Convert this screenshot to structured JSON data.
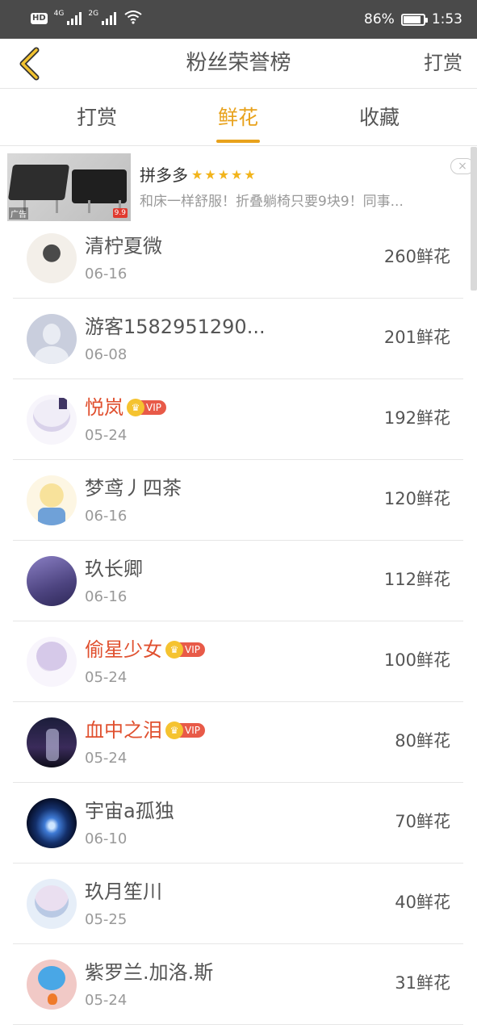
{
  "status_bar": {
    "hd": "HD",
    "network1": "4G",
    "network2": "2G",
    "battery": "86%",
    "battery_level": 0.86,
    "time": "1:53"
  },
  "header": {
    "title": "粉丝荣誉榜",
    "right_action": "打赏"
  },
  "tabs": [
    {
      "label": "打赏",
      "active": false
    },
    {
      "label": "鲜花",
      "active": true
    },
    {
      "label": "收藏",
      "active": false
    }
  ],
  "ad": {
    "title": "拼多多",
    "stars": "★★★★★",
    "description": "和床一样舒服！折叠躺椅只要9块9！同事...",
    "ad_label": "广告",
    "price_tag": "9.9",
    "close": "×"
  },
  "fans": [
    {
      "name": "清柠夏微",
      "date": "06-16",
      "amount": "260鲜花",
      "vip": false
    },
    {
      "name": "游客1582951290...",
      "date": "06-08",
      "amount": "201鲜花",
      "vip": false
    },
    {
      "name": "悦岚",
      "date": "05-24",
      "amount": "192鲜花",
      "vip": true
    },
    {
      "name": "梦鸢丿四茶",
      "date": "06-16",
      "amount": "120鲜花",
      "vip": false
    },
    {
      "name": "玖长卿",
      "date": "06-16",
      "amount": "112鲜花",
      "vip": false
    },
    {
      "name": "偷星少女",
      "date": "05-24",
      "amount": "100鲜花",
      "vip": true
    },
    {
      "name": "血中之泪",
      "date": "05-24",
      "amount": "80鲜花",
      "vip": true
    },
    {
      "name": "宇宙a孤独",
      "date": "06-10",
      "amount": "70鲜花",
      "vip": false
    },
    {
      "name": "玖月笙川",
      "date": "05-25",
      "amount": "40鲜花",
      "vip": false
    },
    {
      "name": "紫罗兰.加洛.斯",
      "date": "05-24",
      "amount": "31鲜花",
      "vip": false
    }
  ],
  "vip_label": "VIP",
  "colors": {
    "accent": "#e8a21c",
    "vip_name": "#e0502f",
    "status_bar": "#4a4a4a"
  }
}
